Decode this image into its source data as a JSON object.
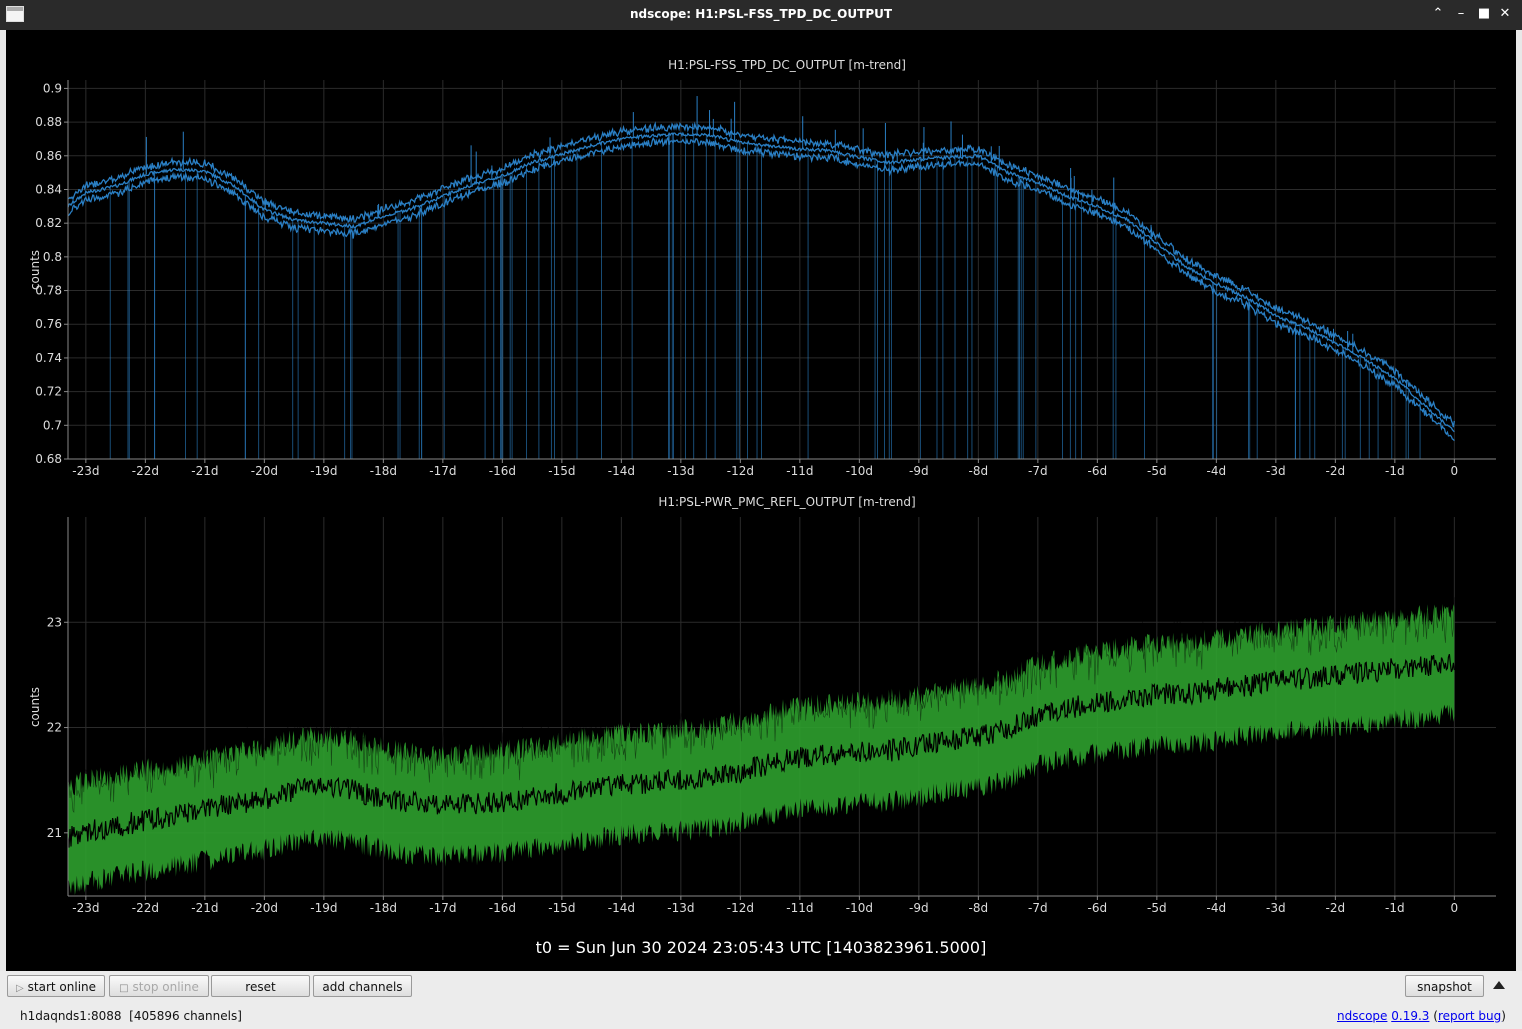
{
  "window": {
    "title": "ndscope: H1:PSL-FSS_TPD_DC_OUTPUT"
  },
  "toolbar": {
    "start_online": "start online",
    "stop_online": "stop online",
    "reset": "reset",
    "add_channels": "add channels",
    "snapshot": "snapshot"
  },
  "status": {
    "server": "h1daqnds1:8088",
    "channels": "[405896 channels]",
    "app_name": "ndscope",
    "version": "0.19.3",
    "paren_open": "(",
    "report_bug": "report bug",
    "paren_close": ")"
  },
  "t0_label": "t0 = Sun Jun 30 2024 23:05:43 UTC [1403823961.5000]",
  "colors": {
    "trace_top": "#2a7fc4",
    "trace_bottom": "#2ea02e",
    "background": "#000000",
    "axis": "#888888",
    "text": "#dddddd"
  },
  "chart_data": [
    {
      "type": "line",
      "title": "H1:PSL-FSS_TPD_DC_OUTPUT [m-trend]",
      "ylabel": "counts",
      "xlim": [
        -23.3,
        0.7
      ],
      "ylim": [
        0.68,
        0.905
      ],
      "xticks": [
        -23,
        -22,
        -21,
        -20,
        -19,
        -18,
        -17,
        -16,
        -15,
        -14,
        -13,
        -12,
        -11,
        -10,
        -9,
        -8,
        -7,
        -6,
        -5,
        -4,
        -3,
        -2,
        -1,
        0
      ],
      "xtick_labels": [
        "-23d",
        "-22d",
        "-21d",
        "-20d",
        "-19d",
        "-18d",
        "-17d",
        "-16d",
        "-15d",
        "-14d",
        "-13d",
        "-12d",
        "-11d",
        "-10d",
        "-9d",
        "-8d",
        "-7d",
        "-6d",
        "-5d",
        "-4d",
        "-3d",
        "-2d",
        "-1d",
        "0"
      ],
      "yticks": [
        0.68,
        0.7,
        0.72,
        0.74,
        0.76,
        0.78,
        0.8,
        0.82,
        0.84,
        0.86,
        0.88,
        0.9
      ],
      "ytick_labels": [
        "0.68",
        "0.7",
        "0.72",
        "0.74",
        "0.76",
        "0.78",
        "0.8",
        "0.82",
        "0.84",
        "0.86",
        "0.88",
        "0.9"
      ],
      "grid": true,
      "series": [
        {
          "x": [
            -23.3,
            -23,
            -22.5,
            -22,
            -21.5,
            -21,
            -20.5,
            -20,
            -19.5,
            -19,
            -18.5,
            -18,
            -17.5,
            -17,
            -16.5,
            -16,
            -15.5,
            -15,
            -14.5,
            -14,
            -13.5,
            -13,
            -12.5,
            -12,
            -11.5,
            -11,
            -10.5,
            -10,
            -9.5,
            -9,
            -8.5,
            -8,
            -7.5,
            -7,
            -6.5,
            -6,
            -5.5,
            -5,
            -4.5,
            -4,
            -3.5,
            -3,
            -2.5,
            -2,
            -1.5,
            -1,
            -0.5,
            0
          ],
          "mean": [
            0.83,
            0.838,
            0.842,
            0.849,
            0.852,
            0.851,
            0.842,
            0.828,
            0.822,
            0.82,
            0.818,
            0.824,
            0.829,
            0.836,
            0.843,
            0.848,
            0.856,
            0.861,
            0.866,
            0.87,
            0.872,
            0.873,
            0.872,
            0.868,
            0.866,
            0.864,
            0.863,
            0.859,
            0.856,
            0.858,
            0.859,
            0.86,
            0.85,
            0.844,
            0.836,
            0.83,
            0.822,
            0.808,
            0.794,
            0.784,
            0.776,
            0.765,
            0.758,
            0.749,
            0.739,
            0.728,
            0.712,
            0.696
          ],
          "band": 0.004
        }
      ]
    },
    {
      "type": "line",
      "title": "H1:PSL-PWR_PMC_REFL_OUTPUT [m-trend]",
      "ylabel": "counts",
      "xlim": [
        -23.3,
        0.7
      ],
      "ylim": [
        20.4,
        24.0
      ],
      "xticks": [
        -23,
        -22,
        -21,
        -20,
        -19,
        -18,
        -17,
        -16,
        -15,
        -14,
        -13,
        -12,
        -11,
        -10,
        -9,
        -8,
        -7,
        -6,
        -5,
        -4,
        -3,
        -2,
        -1,
        0
      ],
      "xtick_labels": [
        "-23d",
        "-22d",
        "-21d",
        "-20d",
        "-19d",
        "-18d",
        "-17d",
        "-16d",
        "-15d",
        "-14d",
        "-13d",
        "-12d",
        "-11d",
        "-10d",
        "-9d",
        "-8d",
        "-7d",
        "-6d",
        "-5d",
        "-4d",
        "-3d",
        "-2d",
        "-1d",
        "0"
      ],
      "yticks": [
        21,
        22,
        23
      ],
      "ytick_labels": [
        "21",
        "22",
        "23"
      ],
      "grid": true,
      "series": [
        {
          "x": [
            -23.3,
            -23,
            -22.5,
            -22,
            -21.5,
            -21,
            -20.5,
            -20,
            -19.5,
            -19,
            -18.5,
            -18,
            -17.5,
            -17,
            -16.5,
            -16,
            -15.5,
            -15,
            -14.5,
            -14,
            -13.5,
            -13,
            -12.5,
            -12,
            -11.5,
            -11,
            -10.5,
            -10,
            -9.5,
            -9,
            -8.5,
            -8,
            -7.5,
            -7,
            -6.5,
            -6,
            -5.5,
            -5,
            -4.5,
            -4,
            -3.5,
            -3,
            -2.5,
            -2,
            -1.5,
            -1,
            -0.5,
            0
          ],
          "mean": [
            20.95,
            21.02,
            21.06,
            21.12,
            21.16,
            21.22,
            21.28,
            21.32,
            21.4,
            21.45,
            21.4,
            21.32,
            21.28,
            21.26,
            21.27,
            21.3,
            21.33,
            21.38,
            21.42,
            21.46,
            21.48,
            21.5,
            21.52,
            21.58,
            21.66,
            21.72,
            21.74,
            21.76,
            21.78,
            21.82,
            21.88,
            21.92,
            21.98,
            22.12,
            22.18,
            22.24,
            22.28,
            22.32,
            22.32,
            22.36,
            22.4,
            22.44,
            22.46,
            22.5,
            22.52,
            22.56,
            22.58,
            22.62
          ],
          "band": 0.42
        }
      ]
    }
  ]
}
